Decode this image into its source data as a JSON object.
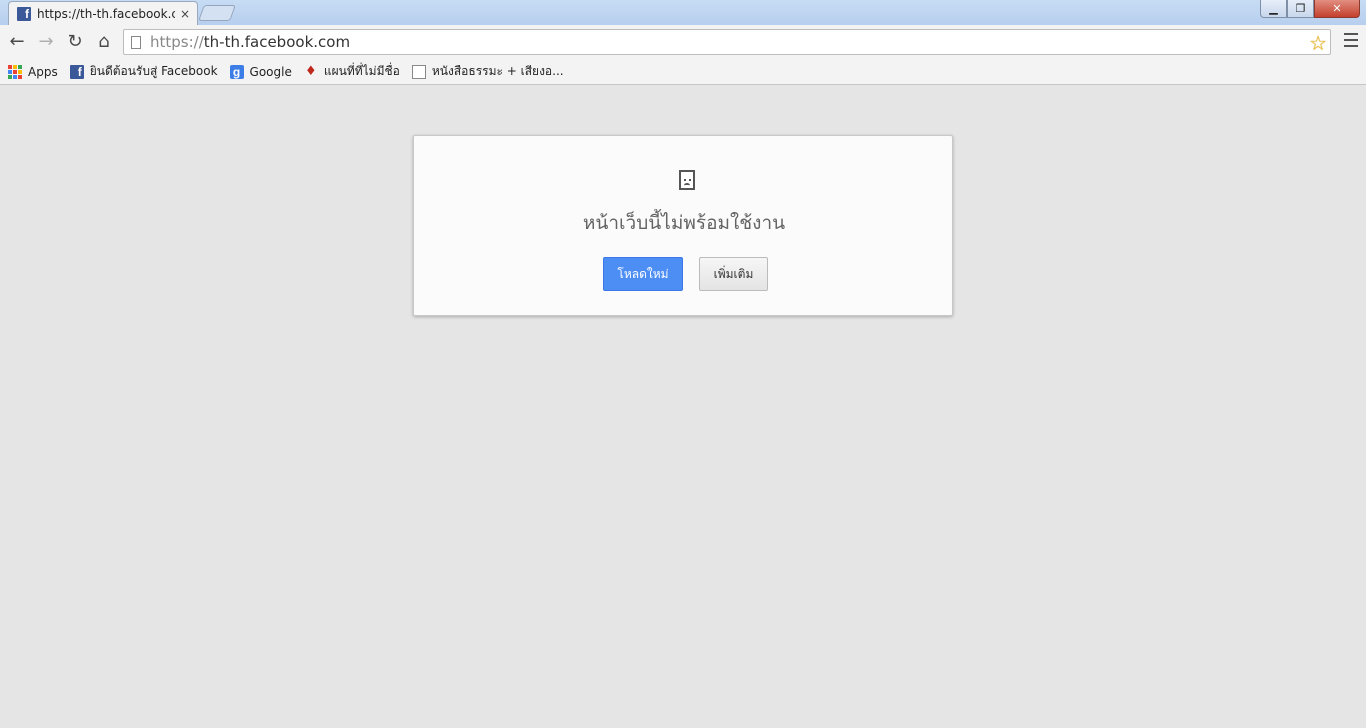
{
  "window": {
    "tab": {
      "title": "https://th-th.facebook.com",
      "favicon": "f",
      "close": "×"
    },
    "controls": {
      "minimize": "▁",
      "maximize": "❐",
      "close": "✕"
    }
  },
  "toolbar": {
    "back": "←",
    "forward": "→",
    "reload": "↻",
    "home": "⌂",
    "url_scheme": "https://",
    "url_rest": "th-th.facebook.com",
    "star": "☆"
  },
  "bookmarks": [
    {
      "label": "Apps",
      "icon": "apps-grid-icon"
    },
    {
      "label": "ยินดีต้อนรับสู่ Facebook",
      "icon": "facebook-icon",
      "glyph": "f"
    },
    {
      "label": "Google",
      "icon": "google-icon",
      "glyph": "g"
    },
    {
      "label": "แผนที่ที่ไม่มีชื่อ",
      "icon": "map-pin-icon",
      "glyph": "♦"
    },
    {
      "label": "หนังสือธรรมะ + เสียงอ...",
      "icon": "page-icon"
    }
  ],
  "error": {
    "title": "หน้าเว็บนี้ไม่พร้อมใช้งาน",
    "reload_label": "โหลดใหม่",
    "more_label": "เพิ่มเติม"
  },
  "colors": {
    "background": "#e5e5e5",
    "accent_button": "#4d8ef5",
    "facebook_blue": "#3b5998"
  }
}
